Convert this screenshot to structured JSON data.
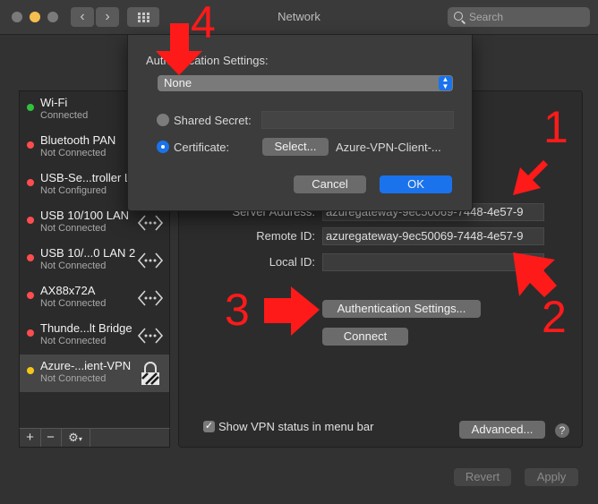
{
  "window": {
    "title": "Network"
  },
  "search": {
    "placeholder": "Search"
  },
  "services": [
    {
      "name": "Wi-Fi",
      "status": "Connected",
      "dot": "#32c13c"
    },
    {
      "name": "Bluetooth PAN",
      "status": "Not Connected",
      "dot": "#ff4d4f"
    },
    {
      "name": "USB-Se...troller L",
      "status": "Not Configured",
      "dot": "#ff4d4f"
    },
    {
      "name": "USB 10/100 LAN",
      "status": "Not Connected",
      "dot": "#ff4d4f"
    },
    {
      "name": "USB 10/...0 LAN 2",
      "status": "Not Connected",
      "dot": "#ff4d4f"
    },
    {
      "name": "AX88x72A",
      "status": "Not Connected",
      "dot": "#ff4d4f"
    },
    {
      "name": "Thunde...lt Bridge",
      "status": "Not Connected",
      "dot": "#ff4d4f"
    },
    {
      "name": "Azure-...ient-VPN",
      "status": "Not Connected",
      "dot": "#f5c518"
    }
  ],
  "toolbar": {
    "add": "+",
    "remove": "−",
    "gear": "⚙"
  },
  "vpn": {
    "server_address_label": "Server Address:",
    "server_address": "azuregateway-9ec50069-7448-4e57-9",
    "remote_id_label": "Remote ID:",
    "remote_id": "azuregateway-9ec50069-7448-4e57-9",
    "local_id_label": "Local ID:",
    "local_id": "",
    "auth_button": "Authentication Settings...",
    "connect_button": "Connect",
    "show_status_label": "Show VPN status in menu bar",
    "show_status_checked": true,
    "advanced_button": "Advanced...",
    "help": "?"
  },
  "footer": {
    "revert": "Revert",
    "apply": "Apply"
  },
  "auth_sheet": {
    "title": "Authentication Settings:",
    "method": "None",
    "shared_secret_label": "Shared Secret:",
    "shared_secret": "",
    "certificate_label": "Certificate:",
    "select_button": "Select...",
    "certificate_name": "Azure-VPN-Client-...",
    "cancel": "Cancel",
    "ok": "OK",
    "selected_option": "certificate"
  },
  "annotations": [
    "1",
    "2",
    "3",
    "4"
  ],
  "colors": {
    "accent": "#1a73ec",
    "annotation": "#ff1a1a"
  }
}
